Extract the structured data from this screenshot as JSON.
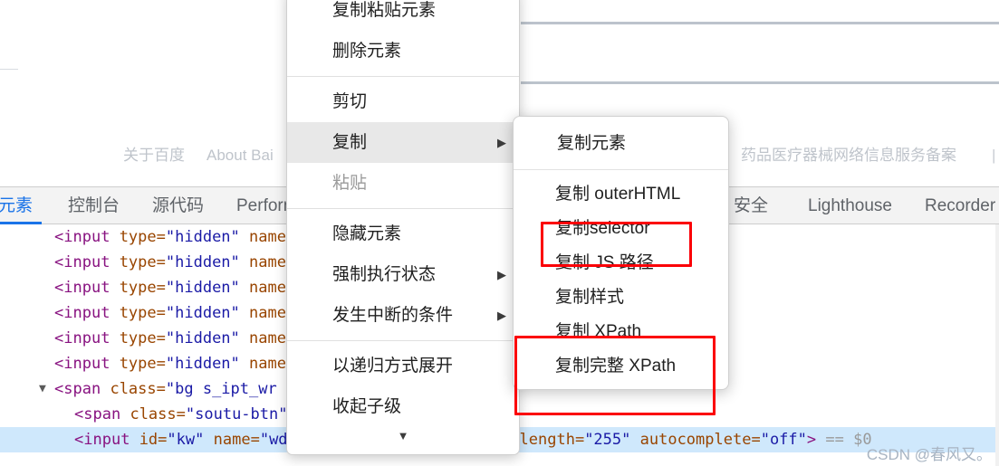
{
  "page": {
    "footer_links": [
      {
        "label": "关于百度"
      },
      {
        "label": "About Bai"
      },
      {
        "label": "药品医疗器械网络信息服务备案"
      },
      {
        "label": "|"
      }
    ]
  },
  "devtools": {
    "tabs": [
      {
        "label": "元素",
        "active": true
      },
      {
        "label": "控制台",
        "active": false
      },
      {
        "label": "源代码",
        "active": false
      },
      {
        "label": "Perform",
        "active": false
      },
      {
        "label": "安全",
        "active": false
      },
      {
        "label": "Lighthouse",
        "active": false
      },
      {
        "label": "Recorder",
        "active": false
      }
    ],
    "dom_rows": [
      {
        "text": "<input type=\"hidden\" name=\"",
        "indent": 1,
        "twisty": "",
        "selected": false
      },
      {
        "text": "<input type=\"hidden\" name=\"",
        "indent": 1,
        "twisty": "",
        "selected": false
      },
      {
        "text": "<input type=\"hidden\" name=\"",
        "indent": 1,
        "twisty": "",
        "selected": false
      },
      {
        "text": "<input type=\"hidden\" name=\"",
        "indent": 1,
        "twisty": "",
        "selected": false
      },
      {
        "text": "<input type=\"hidden\" name=\"",
        "indent": 1,
        "twisty": "",
        "selected": false
      },
      {
        "text": "<input type=\"hidden\" name=\"",
        "indent": 1,
        "twisty": "",
        "selected": false
      },
      {
        "text": "<span class=\"bg s_ipt_wr ne",
        "indent": 1,
        "twisty": "▼",
        "selected": false
      },
      {
        "text": "<span class=\"soutu-btn\"><",
        "indent": 2,
        "twisty": "",
        "selected": false
      },
      {
        "text": "<input id=\"kw\" name=\"wd\" class=\"s_ipt\" value maxlength=\"255\" autocomplete=\"off\"> == $0",
        "indent": 2,
        "twisty": "",
        "selected": true
      }
    ],
    "watermark": "CSDN @春风又。"
  },
  "context_menu": {
    "items": [
      {
        "label": "复制粘贴元素",
        "state": "normal",
        "submenu": false
      },
      {
        "label": "删除元素",
        "state": "normal",
        "submenu": false
      },
      {
        "label": "__sep__",
        "state": "sep",
        "submenu": false
      },
      {
        "label": "剪切",
        "state": "normal",
        "submenu": false
      },
      {
        "label": "复制",
        "state": "highlighted",
        "submenu": true
      },
      {
        "label": "粘贴",
        "state": "disabled",
        "submenu": false
      },
      {
        "label": "__sep__",
        "state": "sep",
        "submenu": false
      },
      {
        "label": "隐藏元素",
        "state": "normal",
        "submenu": false
      },
      {
        "label": "强制执行状态",
        "state": "normal",
        "submenu": true
      },
      {
        "label": "发生中断的条件",
        "state": "normal",
        "submenu": true
      },
      {
        "label": "__sep__",
        "state": "sep",
        "submenu": false
      },
      {
        "label": "以递归方式展开",
        "state": "normal",
        "submenu": false
      },
      {
        "label": "收起子级",
        "state": "normal",
        "submenu": false
      }
    ],
    "scroll_down_icon": "▼",
    "submenu_arrow_icon": "▶"
  },
  "submenu": {
    "items": [
      {
        "label": "复制元素",
        "highlighted": false
      },
      {
        "label": "__sep__",
        "highlighted": false
      },
      {
        "label": "复制 outerHTML",
        "highlighted": false
      },
      {
        "label": "复制selector",
        "highlighted": true
      },
      {
        "label": "复制 JS 路径",
        "highlighted": false
      },
      {
        "label": "复制样式",
        "highlighted": false
      },
      {
        "label": "复制 XPath",
        "highlighted": true
      },
      {
        "label": "复制完整 XPath",
        "highlighted": true
      }
    ]
  },
  "annotation": {
    "highlight_color": "#fb0007",
    "accent_color": "#1a73e8",
    "selected_row_color": "#cfe8fc"
  }
}
